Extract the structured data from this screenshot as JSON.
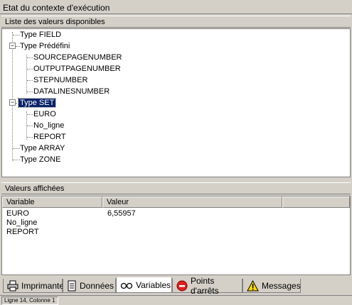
{
  "window": {
    "title": "Etat du contexte d'exécution"
  },
  "tree_section": {
    "header": "Liste des valeurs disponibles",
    "items": [
      {
        "label": "Type FIELD"
      },
      {
        "label": "Type Prédéfini",
        "expander": "−"
      },
      {
        "label": "SOURCEPAGENUMBER"
      },
      {
        "label": "OUTPUTPAGENUMBER"
      },
      {
        "label": "STEPNUMBER"
      },
      {
        "label": "DATALINESNUMBER"
      },
      {
        "label": "Type SET",
        "expander": "−",
        "selected": true
      },
      {
        "label": "EURO"
      },
      {
        "label": "No_ligne"
      },
      {
        "label": "REPORT"
      },
      {
        "label": "Type ARRAY"
      },
      {
        "label": "Type ZONE"
      }
    ]
  },
  "values_section": {
    "header": "Valeurs affichées",
    "columns": [
      "Variable",
      "Valeur"
    ],
    "rows": [
      {
        "variable": "EURO",
        "value": "6,55957"
      },
      {
        "variable": "No_ligne",
        "value": ""
      },
      {
        "variable": "REPORT",
        "value": ""
      }
    ]
  },
  "tabs": [
    {
      "label": "Imprimante",
      "icon": "printer-icon"
    },
    {
      "label": "Données",
      "icon": "document-icon"
    },
    {
      "label": "Variables",
      "icon": "glasses-icon",
      "active": true
    },
    {
      "label": "Points d'arrêts",
      "icon": "stop-icon"
    },
    {
      "label": "Messages",
      "icon": "warning-icon"
    }
  ],
  "status": {
    "text": "Ligne 14, Colonne 1"
  },
  "colors": {
    "selection": "#0a246a",
    "panel": "#d4d0c8"
  }
}
